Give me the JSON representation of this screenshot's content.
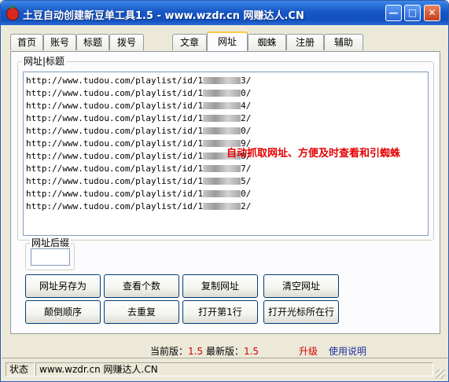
{
  "window": {
    "title": "土豆自动创建新豆单工具1.5 - www.wzdr.cn 网赚达人.CN",
    "icon": "bag-icon",
    "controls": [
      "minimize",
      "maximize",
      "close"
    ]
  },
  "tabs": [
    {
      "label": "首页",
      "active": false
    },
    {
      "label": "账号",
      "active": false
    },
    {
      "label": "标题",
      "active": false
    },
    {
      "label": "拨号",
      "active": false
    },
    {
      "label": "文章",
      "active": false
    },
    {
      "label": "网址",
      "active": true
    },
    {
      "label": "蜘蛛",
      "active": false
    },
    {
      "label": "注册",
      "active": false
    },
    {
      "label": "辅助",
      "active": false
    }
  ],
  "url_group": {
    "label": "网址|标题",
    "lines": [
      {
        "prefix": "http://www.tudou.com/playlist/id/1",
        "suffix": "3/"
      },
      {
        "prefix": "http://www.tudou.com/playlist/id/1",
        "suffix": "0/"
      },
      {
        "prefix": "http://www.tudou.com/playlist/id/1",
        "suffix": "4/"
      },
      {
        "prefix": "http://www.tudou.com/playlist/id/1",
        "suffix": "2/"
      },
      {
        "prefix": "http://www.tudou.com/playlist/id/1",
        "suffix": "0/"
      },
      {
        "prefix": "http://www.tudou.com/playlist/id/1",
        "suffix": "9/"
      },
      {
        "prefix": "http://www.tudou.com/playlist/id/1",
        "suffix": "8/"
      },
      {
        "prefix": "http://www.tudou.com/playlist/id/1",
        "suffix": "7/"
      },
      {
        "prefix": "http://www.tudou.com/playlist/id/1",
        "suffix": "5/"
      },
      {
        "prefix": "http://www.tudou.com/playlist/id/1",
        "suffix": "0/"
      },
      {
        "prefix": "http://www.tudou.com/playlist/id/1",
        "suffix": "2/"
      }
    ],
    "overlay_note": "自动抓取网址、方便及时查看和引蜘蛛"
  },
  "suffix_group": {
    "label": "网址后缀",
    "value": ""
  },
  "buttons": {
    "row1": [
      "网址另存为",
      "查看个数",
      "复制网址",
      "清空网址"
    ],
    "row2": [
      "颠倒顺序",
      "去重复",
      "打开第1行",
      "打开光标所在行"
    ]
  },
  "version": {
    "current_label": "当前版：",
    "current_value": "1.5",
    "latest_label": "最新版：",
    "latest_value": "1.5",
    "upgrade_link": "升级",
    "help_link": "使用说明"
  },
  "statusbar": {
    "label": "状态",
    "text": "www.wzdr.cn 网赚达人.CN"
  }
}
